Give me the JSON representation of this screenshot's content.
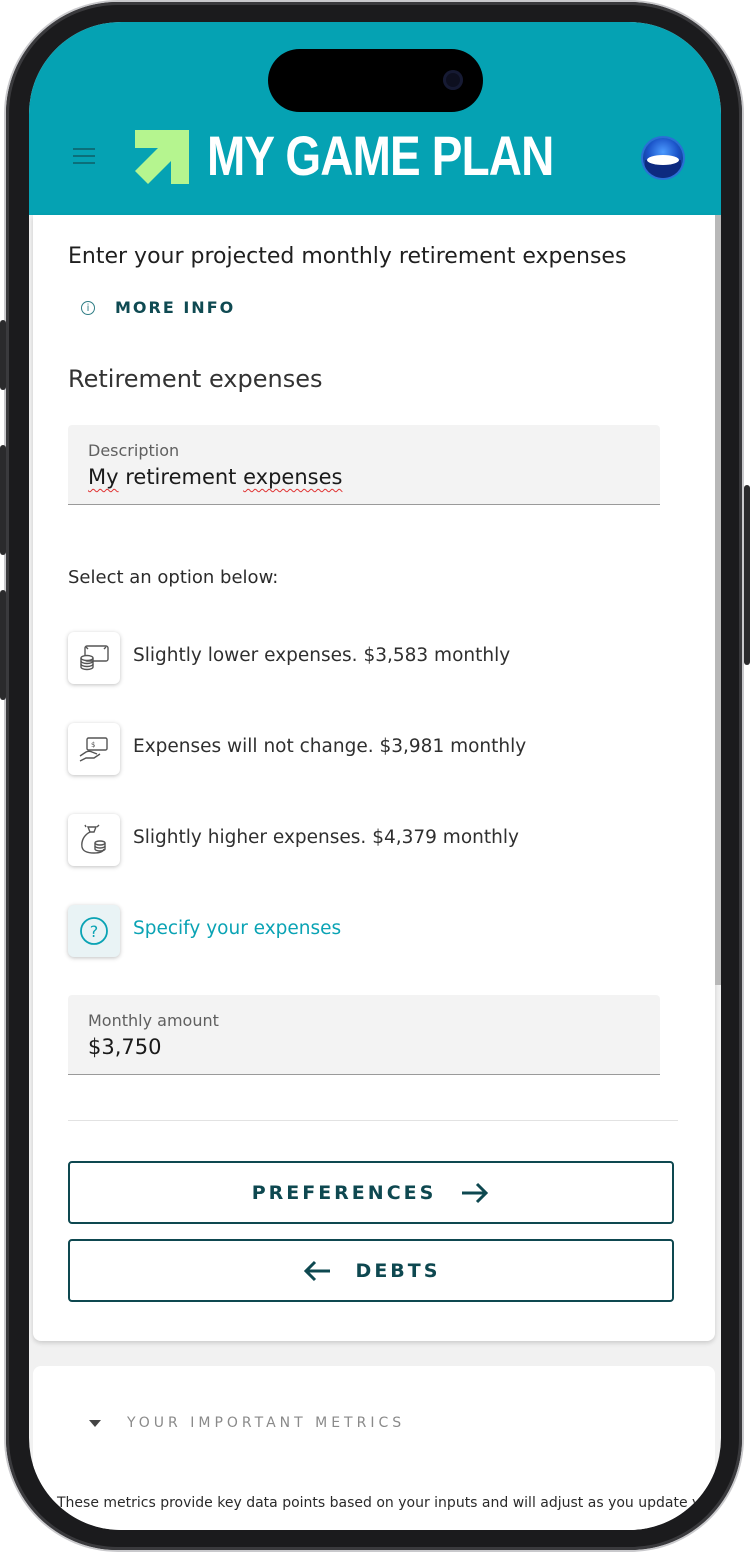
{
  "header": {
    "logo_text": "MY GAME PLAN",
    "colors": {
      "bar": "#05a2b3",
      "logo_arrow": "#b5f58f"
    }
  },
  "intro": {
    "title": "Enter your projected monthly retirement expenses",
    "more_info": "MORE INFO"
  },
  "section_title": "Retirement expenses",
  "description_field": {
    "label": "Description",
    "value_word1": "My",
    "value_word2": "retirement",
    "value_word3": "expenses"
  },
  "options": {
    "prompt": "Select an option below:",
    "items": [
      {
        "icon": "coins-screen-icon",
        "label": "Slightly lower expenses. $3,583 monthly"
      },
      {
        "icon": "hand-cash-icon",
        "label": "Expenses will not change. $3,981 monthly"
      },
      {
        "icon": "money-bag-icon",
        "label": "Slightly higher expenses. $4,379 monthly"
      },
      {
        "icon": "question-icon",
        "label": "Specify your expenses"
      }
    ]
  },
  "monthly_field": {
    "label": "Monthly amount",
    "value": "$3,750"
  },
  "buttons": {
    "next": "PREFERENCES",
    "back": "DEBTS"
  },
  "metrics": {
    "title": "YOUR IMPORTANT METRICS",
    "description": "These metrics provide key data points based on your inputs and will adjust as you update your"
  }
}
